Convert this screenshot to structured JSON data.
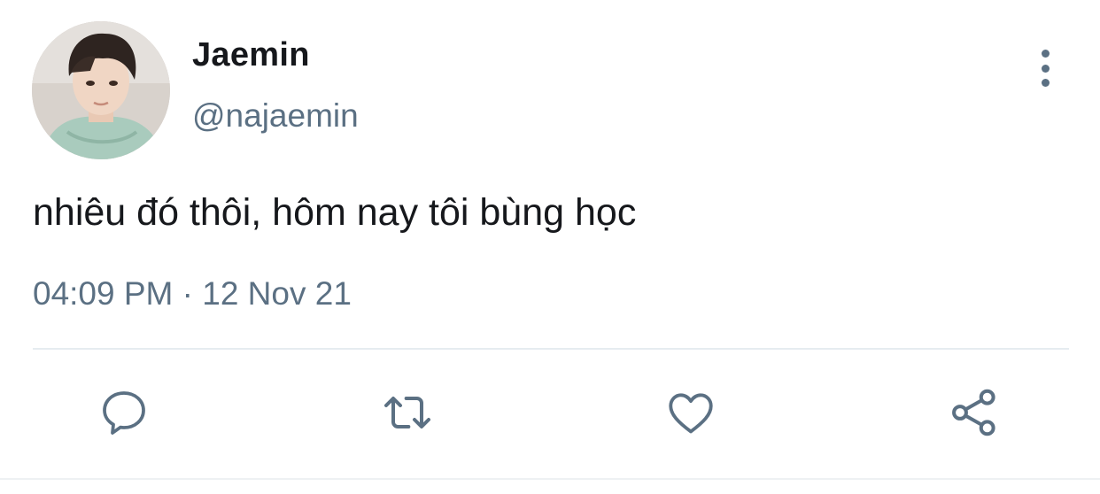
{
  "tweet": {
    "author": {
      "display_name": "Jaemin",
      "handle": "@najaemin"
    },
    "text": "nhiêu đó thôi, hôm nay tôi bùng học",
    "timestamp": "04:09 PM · 12 Nov 21"
  },
  "actions": [
    {
      "name": "reply",
      "icon": "comment-icon"
    },
    {
      "name": "retweet",
      "icon": "retweet-icon"
    },
    {
      "name": "like",
      "icon": "heart-icon"
    },
    {
      "name": "share",
      "icon": "share-icon"
    }
  ],
  "colors": {
    "primary_text": "#16181c",
    "secondary_text": "#5b7083",
    "divider": "#e6ecf0",
    "background": "#ffffff"
  }
}
